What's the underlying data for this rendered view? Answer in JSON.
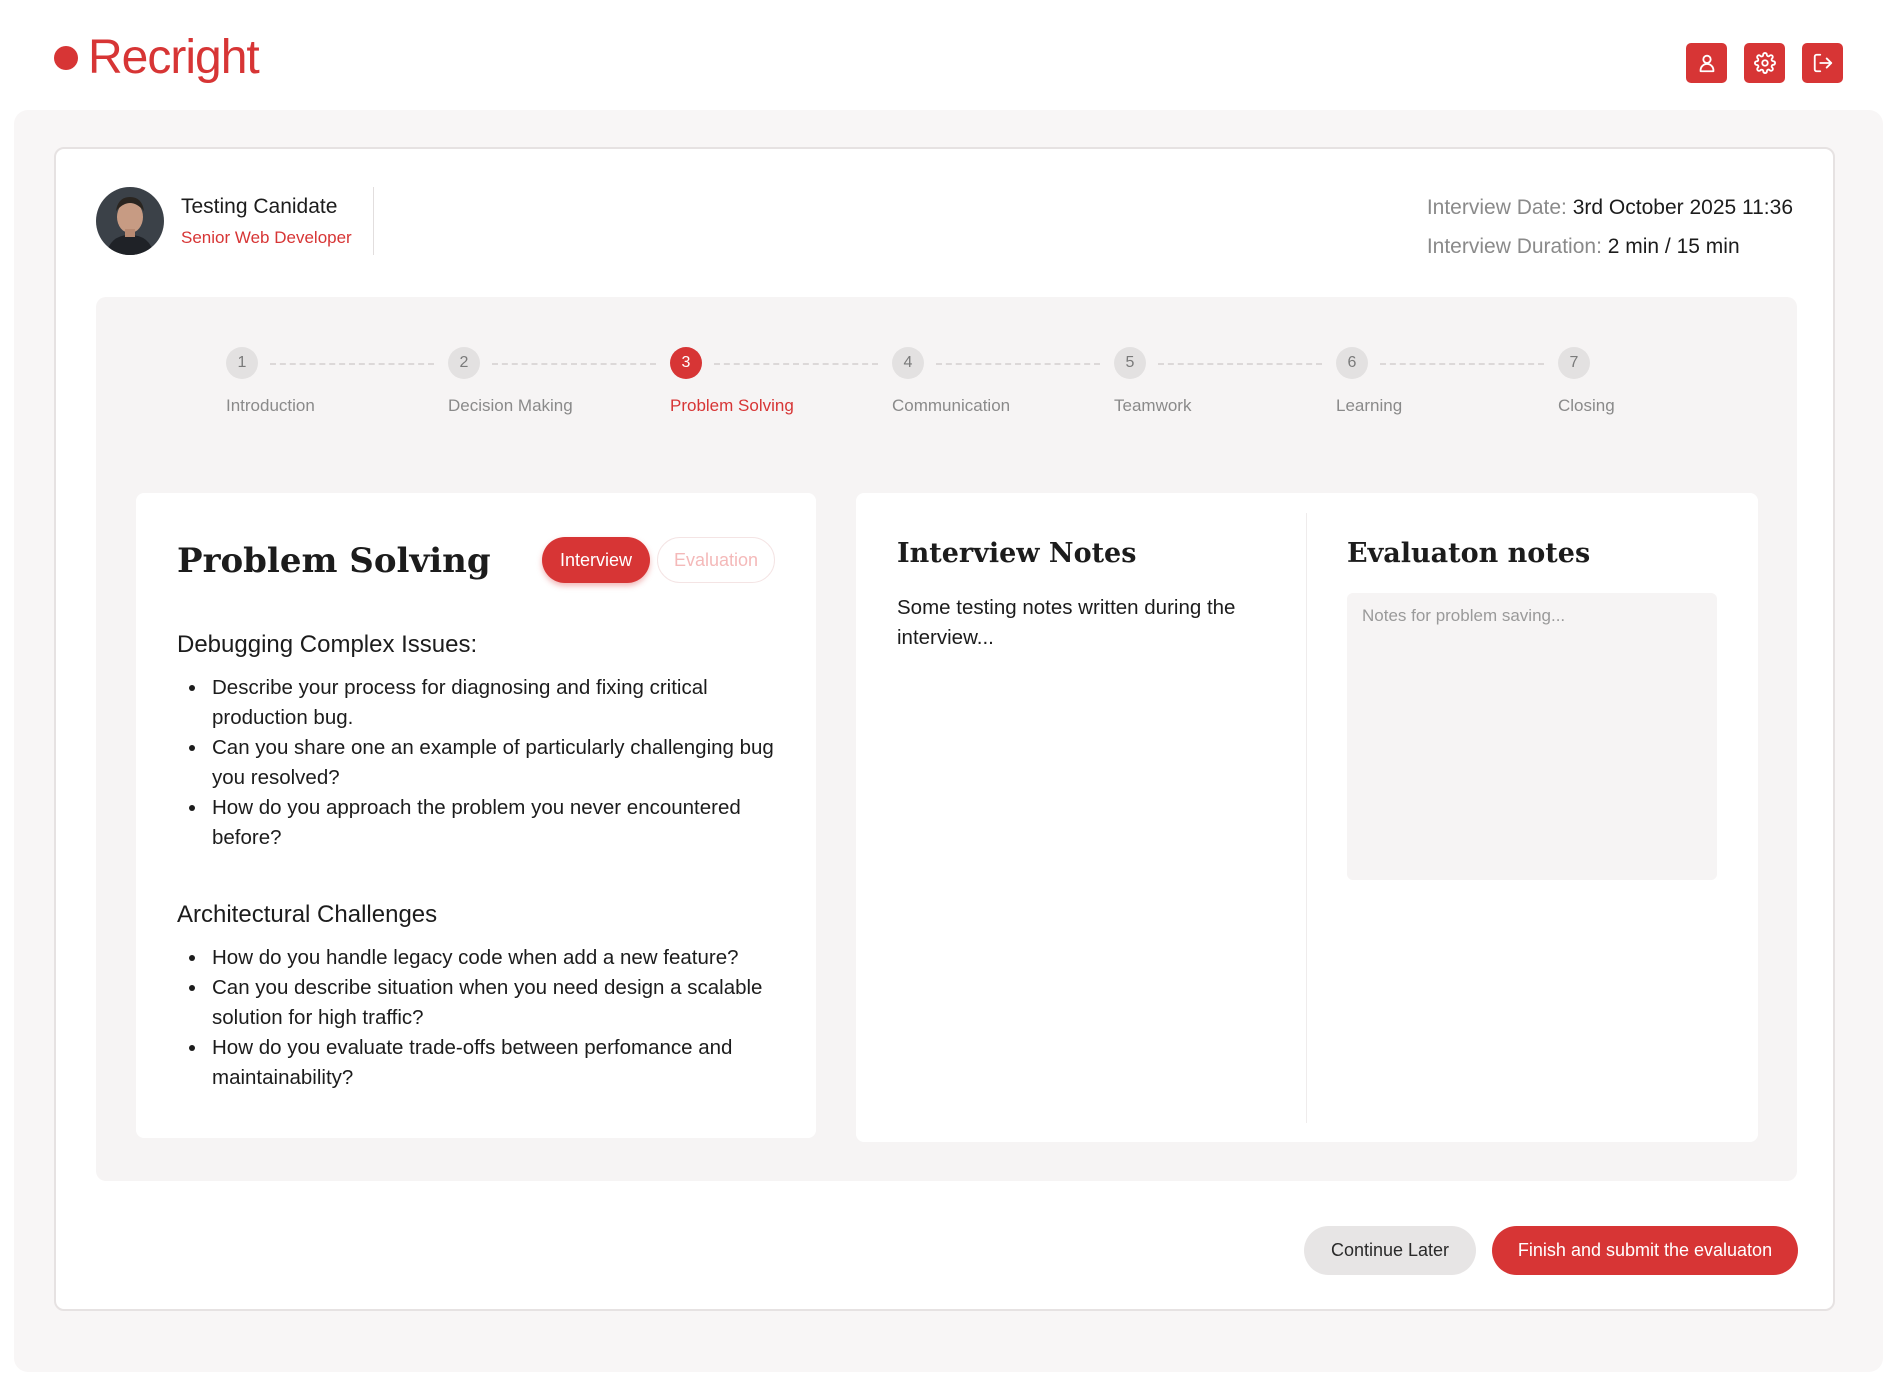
{
  "app": {
    "brand": "Recright",
    "colors": {
      "accent": "#d73535",
      "text": "#1c1c1c",
      "muted": "#8a8a8a"
    }
  },
  "header_actions": [
    {
      "icon": "user-icon"
    },
    {
      "icon": "gear-icon"
    },
    {
      "icon": "logout-icon"
    }
  ],
  "candidate": {
    "name": "Testing Canidate",
    "role": "Senior Web Developer"
  },
  "interview_meta": {
    "date_label": "Interview Date:",
    "date_value": "3rd October 2025 11:36",
    "duration_label": "Interview Duration:",
    "duration_value": "2 min / 15 min"
  },
  "steps": [
    {
      "num": "1",
      "label": "Introduction"
    },
    {
      "num": "2",
      "label": "Decision Making"
    },
    {
      "num": "3",
      "label": "Problem Solving",
      "active": true
    },
    {
      "num": "4",
      "label": "Communication"
    },
    {
      "num": "5",
      "label": "Teamwork"
    },
    {
      "num": "6",
      "label": "Learning"
    },
    {
      "num": "7",
      "label": "Closing"
    }
  ],
  "question_panel": {
    "title": "Problem Solving",
    "toggle": {
      "interview": "Interview",
      "evaluation": "Evaluation",
      "selected": "Interview"
    },
    "sections": [
      {
        "heading": "Debugging Complex Issues:",
        "items": [
          "Describe your process for diagnosing and fixing critical production bug.",
          "Can you share one an example of particularly challenging bug you resolved?",
          "How do you approach the problem you never encountered before?"
        ]
      },
      {
        "heading": "Architectural Challenges",
        "items": [
          "How do you handle legacy code when add a new feature?",
          "Can you describe situation when you need design a scalable solution for high traffic?",
          "How do you evaluate trade-offs between perfomance and maintainability?"
        ]
      }
    ]
  },
  "notes": {
    "interview_title": "Interview Notes",
    "interview_text": "Some testing notes written during the interview...",
    "evaluation_title": "Evaluaton notes",
    "evaluation_placeholder": "Notes for problem saving...",
    "evaluation_value": ""
  },
  "footer": {
    "continue_label": "Continue Later",
    "submit_label": "Finish and submit the evaluaton"
  }
}
